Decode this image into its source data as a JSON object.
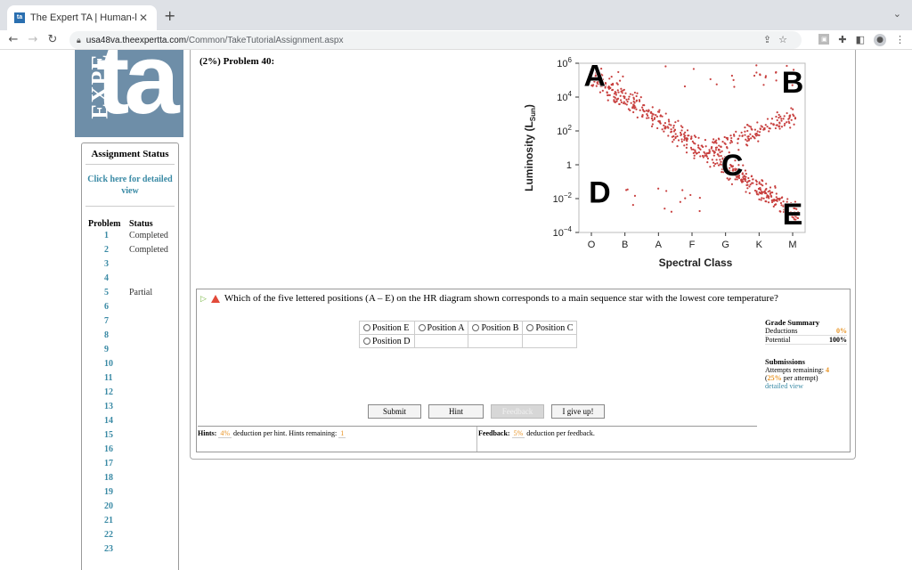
{
  "browser": {
    "tab_title": "The Expert TA | Human-like Gr",
    "tab_favicon_text": "ta",
    "url_host": "usa48va.theexpertta.com",
    "url_path": "/Common/TakeTutorialAssignment.aspx"
  },
  "logo": {
    "vertical_text": "EXPE",
    "big_text": "ta"
  },
  "sidebar": {
    "header": "Assignment Status",
    "detail_link": "Click here for detailed view",
    "col_problem": "Problem",
    "col_status": "Status",
    "problems": [
      {
        "num": "1",
        "status": "Completed"
      },
      {
        "num": "2",
        "status": "Completed"
      },
      {
        "num": "3",
        "status": ""
      },
      {
        "num": "4",
        "status": ""
      },
      {
        "num": "5",
        "status": "Partial"
      },
      {
        "num": "6",
        "status": ""
      },
      {
        "num": "7",
        "status": ""
      },
      {
        "num": "8",
        "status": ""
      },
      {
        "num": "9",
        "status": ""
      },
      {
        "num": "10",
        "status": ""
      },
      {
        "num": "11",
        "status": ""
      },
      {
        "num": "12",
        "status": ""
      },
      {
        "num": "13",
        "status": ""
      },
      {
        "num": "14",
        "status": ""
      },
      {
        "num": "15",
        "status": ""
      },
      {
        "num": "16",
        "status": ""
      },
      {
        "num": "17",
        "status": ""
      },
      {
        "num": "18",
        "status": ""
      },
      {
        "num": "19",
        "status": ""
      },
      {
        "num": "20",
        "status": ""
      },
      {
        "num": "21",
        "status": ""
      },
      {
        "num": "22",
        "status": ""
      },
      {
        "num": "23",
        "status": ""
      }
    ]
  },
  "problem": {
    "title": "(2%) Problem 40:",
    "question": "Which of the five lettered positions (A – E) on the HR diagram shown corresponds to a main sequence star with the lowest core temperature?",
    "options_row1": [
      "Position E",
      "Position A",
      "Position B",
      "Position C"
    ],
    "options_row2": [
      "Position D"
    ],
    "buttons": {
      "submit": "Submit",
      "hint": "Hint",
      "feedback": "Feedback",
      "giveup": "I give up!"
    },
    "hints_label": "Hints:",
    "hints_pct": "4%",
    "hints_text": "deduction per hint. Hints remaining:",
    "hints_remaining": "1",
    "feedback_label": "Feedback:",
    "feedback_pct": "5%",
    "feedback_text": "deduction per feedback."
  },
  "grade": {
    "title": "Grade Summary",
    "deductions_label": "Deductions",
    "deductions_value": "0%",
    "potential_label": "Potential",
    "potential_value": "100%",
    "submissions_title": "Submissions",
    "attempts_label": "Attempts remaining:",
    "attempts_value": "4",
    "per_attempt_pct": "25%",
    "per_attempt_text": "per attempt)",
    "detailed_link": "detailed view"
  },
  "chart_data": {
    "type": "scatter",
    "xlabel": "Spectral Class",
    "ylabel": "Luminosity (L_Sun)",
    "ylabel_main": "Luminosity (L",
    "ylabel_sub": "Sun",
    "ylabel_end": ")",
    "categories": [
      "O",
      "B",
      "A",
      "F",
      "G",
      "K",
      "M"
    ],
    "y_ticks": [
      {
        "base": "10",
        "exp": "6"
      },
      {
        "base": "10",
        "exp": "4"
      },
      {
        "base": "10",
        "exp": "2"
      },
      {
        "base": "1",
        "exp": ""
      },
      {
        "base": "10",
        "exp": "−2"
      },
      {
        "base": "10",
        "exp": "−4"
      }
    ],
    "ylim_log10": [
      -4,
      6
    ],
    "point_color": "#c8403f",
    "labels": [
      {
        "text": "A",
        "x": 0.1,
        "y": 5.3
      },
      {
        "text": "B",
        "x": 6.0,
        "y": 4.9
      },
      {
        "text": "C",
        "x": 4.2,
        "y": 0.0
      },
      {
        "text": "D",
        "x": 0.25,
        "y": -1.6
      },
      {
        "text": "E",
        "x": 6.0,
        "y": -2.9
      }
    ]
  }
}
